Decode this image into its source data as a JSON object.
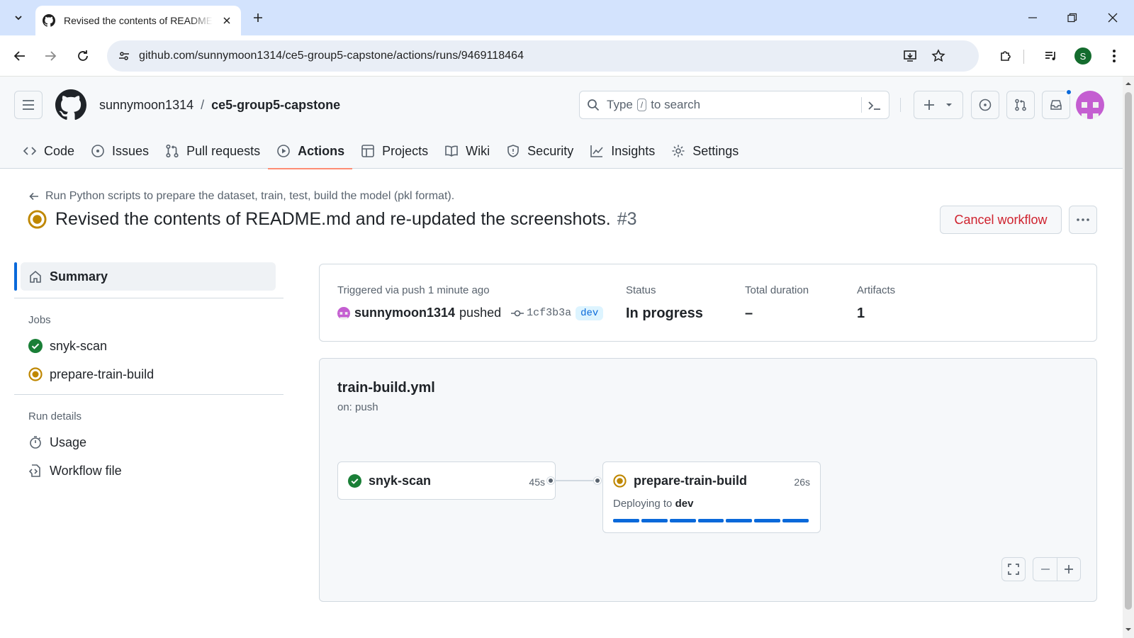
{
  "browser": {
    "tab_title": "Revised the contents of README.md and re-updated the screenshots",
    "url": "github.com/sunnymoon1314/ce5-group5-capstone/actions/runs/9469118464",
    "profile_initial": "S"
  },
  "header": {
    "owner": "sunnymoon1314",
    "slash": "/",
    "repo": "ce5-group5-capstone",
    "search_prefix": "Type",
    "search_key": "/",
    "search_suffix": "to search"
  },
  "nav": {
    "items": [
      {
        "label": "Code",
        "icon": "code-icon"
      },
      {
        "label": "Issues",
        "icon": "issue-icon"
      },
      {
        "label": "Pull requests",
        "icon": "pull-request-icon"
      },
      {
        "label": "Actions",
        "icon": "play-icon"
      },
      {
        "label": "Projects",
        "icon": "table-icon"
      },
      {
        "label": "Wiki",
        "icon": "book-icon"
      },
      {
        "label": "Security",
        "icon": "shield-icon"
      },
      {
        "label": "Insights",
        "icon": "graph-icon"
      },
      {
        "label": "Settings",
        "icon": "gear-icon"
      }
    ],
    "active": "Actions"
  },
  "run": {
    "back_label": "Run Python scripts to prepare the dataset, train, test, build the model (pkl format).",
    "title": "Revised the contents of README.md and re-updated the screenshots.",
    "number": "#3",
    "cancel_label": "Cancel workflow"
  },
  "sidebar": {
    "summary_label": "Summary",
    "jobs_heading": "Jobs",
    "jobs": [
      {
        "label": "snyk-scan",
        "status": "success"
      },
      {
        "label": "prepare-train-build",
        "status": "in_progress"
      }
    ],
    "run_details_heading": "Run details",
    "details": [
      {
        "label": "Usage",
        "icon": "stopwatch-icon"
      },
      {
        "label": "Workflow file",
        "icon": "file-code-icon"
      }
    ]
  },
  "summary": {
    "trigger_label": "Triggered via push 1 minute ago",
    "actor": "sunnymoon1314",
    "action": "pushed",
    "commit": "1cf3b3a",
    "branch": "dev",
    "status_label": "Status",
    "status_value": "In progress",
    "duration_label": "Total duration",
    "duration_value": "–",
    "artifacts_label": "Artifacts",
    "artifacts_value": "1"
  },
  "graph": {
    "workflow_file": "train-build.yml",
    "trigger": "on: push",
    "jobs": [
      {
        "name": "snyk-scan",
        "time": "45s",
        "status": "success"
      },
      {
        "name": "prepare-train-build",
        "time": "26s",
        "status": "in_progress",
        "sub_prefix": "Deploying to",
        "sub_env": "dev"
      }
    ]
  },
  "colors": {
    "accent": "#0969da",
    "success": "#1a7f37",
    "in_progress": "#bf8700",
    "danger": "#cf222e",
    "nav_underline": "#fd8c73"
  }
}
